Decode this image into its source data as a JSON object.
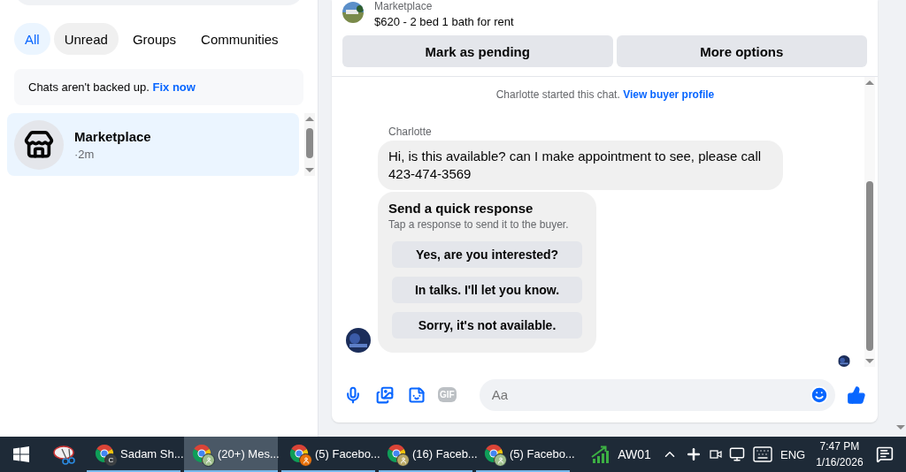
{
  "filter_tabs": [
    {
      "label": "All",
      "selected": true,
      "hovered": false
    },
    {
      "label": "Unread",
      "selected": false,
      "hovered": true
    },
    {
      "label": "Groups",
      "selected": false,
      "hovered": false
    },
    {
      "label": "Communities",
      "selected": false,
      "hovered": false
    }
  ],
  "backup_notice": {
    "text": "Chats aren't backed up.",
    "link": "Fix now"
  },
  "chats": [
    {
      "name": "Marketplace",
      "time": "·2m",
      "selected": true
    }
  ],
  "listing": {
    "source": "Marketplace",
    "title": "$620 - 2 bed 1 bath for rent"
  },
  "actions": [
    "Mark as pending",
    "More options"
  ],
  "conversation": {
    "notice": "Charlotte started this chat.",
    "notice_link": "View buyer profile",
    "sender": "Charlotte",
    "message": "Hi, is this available? can I make appointment to see, please call 423-474-3569",
    "quick_response": {
      "title": "Send a quick response",
      "subtitle": "Tap a response to send it to the buyer.",
      "options": [
        "Yes, are you interested?",
        "In talks. I'll let you know.",
        "Sorry, it's not available."
      ]
    }
  },
  "composer": {
    "gif_label": "GIF",
    "placeholder": "Aa"
  },
  "taskbar": {
    "apps": [
      {
        "label": "Sadam Sh...",
        "selected": false,
        "kind": "letter",
        "badge_text": "C",
        "color": "#3c4043"
      },
      {
        "label": "(20+) Mes...",
        "selected": true,
        "kind": "person",
        "color": "#9fbf8c"
      },
      {
        "label": "(5) Facebo...",
        "selected": false,
        "kind": "person",
        "color": "#e8710a"
      },
      {
        "label": "(16) Faceb...",
        "selected": false,
        "kind": "person",
        "color": "#b8a865"
      },
      {
        "label": "(5) Facebo...",
        "selected": false,
        "kind": "person",
        "color": "#9fbf8c"
      }
    ],
    "pinned_label": "AW01",
    "language": "ENG",
    "time": "7:47 PM",
    "date": "1/16/2026"
  }
}
